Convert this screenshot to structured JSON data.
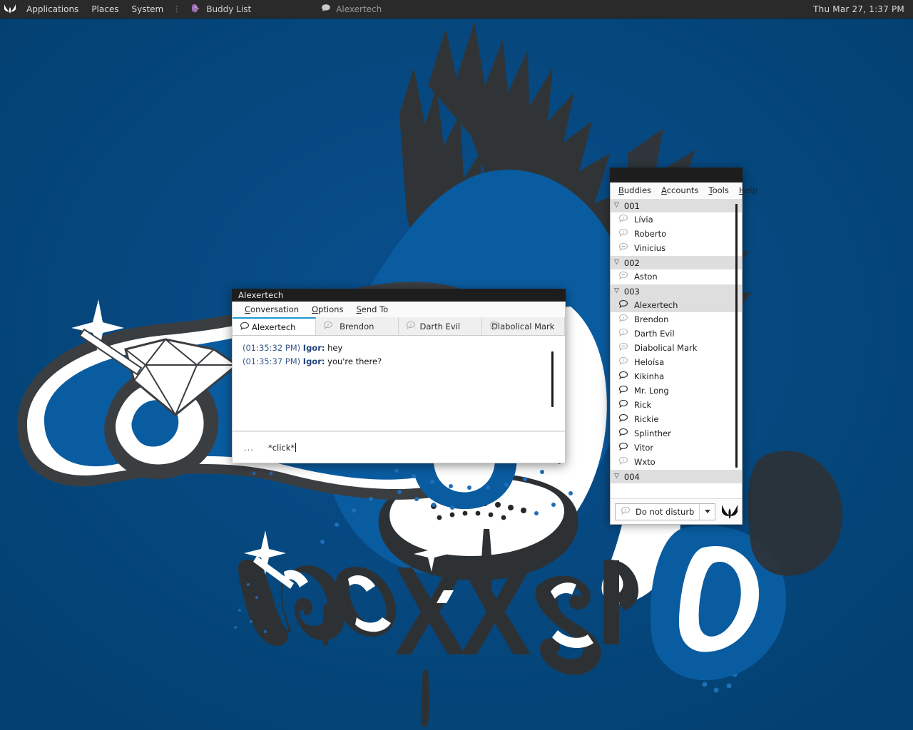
{
  "panel": {
    "logo_icon": "pidgin-wing-logo",
    "menus": [
      {
        "label": "Applications",
        "name": "applications"
      },
      {
        "label": "Places",
        "name": "places"
      },
      {
        "label": "System",
        "name": "system"
      }
    ],
    "separator": "⋮",
    "tasks": [
      {
        "label": "Buddy List",
        "icon": "pidgin-bird-icon",
        "active": true
      },
      {
        "label": "Alexertech",
        "icon": "chat-bubble-icon",
        "active": false
      }
    ],
    "clock": "Thu Mar 27,  1:37 PM"
  },
  "conversation": {
    "title": "Alexertech",
    "menus": [
      {
        "label": "Conversation",
        "mnemonic": "C"
      },
      {
        "label": "Options",
        "mnemonic": "O"
      },
      {
        "label": "Send To",
        "mnemonic": "S"
      }
    ],
    "tabs": [
      {
        "label": "Alexertech",
        "status": "available",
        "active": true
      },
      {
        "label": "Brendon",
        "status": "away",
        "active": false
      },
      {
        "label": "Darth Evil",
        "status": "away",
        "active": false
      },
      {
        "label": "Diabolical Mark",
        "status": "offline",
        "active": false
      }
    ],
    "messages": [
      {
        "time": "(01:35:32 PM)",
        "sender": "Igor:",
        "text": "hey"
      },
      {
        "time": "(01:35:37 PM)",
        "sender": "Igor:",
        "text": "you're there?"
      }
    ],
    "entry": {
      "prefix": "...",
      "value": "*click*"
    }
  },
  "buddy_list": {
    "title": "",
    "menus": [
      {
        "label": "Buddies",
        "mnemonic": "B"
      },
      {
        "label": "Accounts",
        "mnemonic": "A"
      },
      {
        "label": "Tools",
        "mnemonic": "T"
      },
      {
        "label": "Help",
        "mnemonic": "H"
      }
    ],
    "groups": [
      {
        "name": "001",
        "expanded": true,
        "buddies": [
          {
            "name": "Lívia",
            "status": "away",
            "selected": false
          },
          {
            "name": "Roberto",
            "status": "away",
            "selected": false
          },
          {
            "name": "Vinicius",
            "status": "offline",
            "selected": false
          }
        ]
      },
      {
        "name": "002",
        "expanded": true,
        "buddies": [
          {
            "name": "Aston",
            "status": "offline",
            "selected": false
          }
        ]
      },
      {
        "name": "003",
        "expanded": true,
        "buddies": [
          {
            "name": "Alexertech",
            "status": "available",
            "selected": true
          },
          {
            "name": "Brendon",
            "status": "away",
            "selected": false
          },
          {
            "name": "Darth Evil",
            "status": "away",
            "selected": false
          },
          {
            "name": "Diabolical Mark",
            "status": "offline",
            "selected": false
          },
          {
            "name": "Heloísa",
            "status": "away",
            "selected": false
          },
          {
            "name": "Kikinha",
            "status": "available",
            "selected": false
          },
          {
            "name": "Mr. Long",
            "status": "available",
            "selected": false
          },
          {
            "name": "Rick",
            "status": "available",
            "selected": false
          },
          {
            "name": "Rickie",
            "status": "available",
            "selected": false
          },
          {
            "name": "Splinther",
            "status": "available",
            "selected": false
          },
          {
            "name": "Vitor",
            "status": "available",
            "selected": false
          },
          {
            "name": "Wxto",
            "status": "away",
            "selected": false
          }
        ]
      },
      {
        "name": "004",
        "expanded": true,
        "buddies": []
      }
    ],
    "status_selector": {
      "label": "Do not disturb",
      "icon": "busy-bubble-icon",
      "dropdown_icon": "chevron-down-icon",
      "logo_icon": "pidgin-wing-logo"
    },
    "collapse_icon": "triangle-down-icon"
  },
  "colors": {
    "desktop_blue": "#034781",
    "accent": "#2196d6",
    "panel": "#2a2a2a",
    "titlebar": "#1d1d1d",
    "group_row": "#dedede",
    "timestamp": "#3a5a8c",
    "sender": "#23437e"
  }
}
